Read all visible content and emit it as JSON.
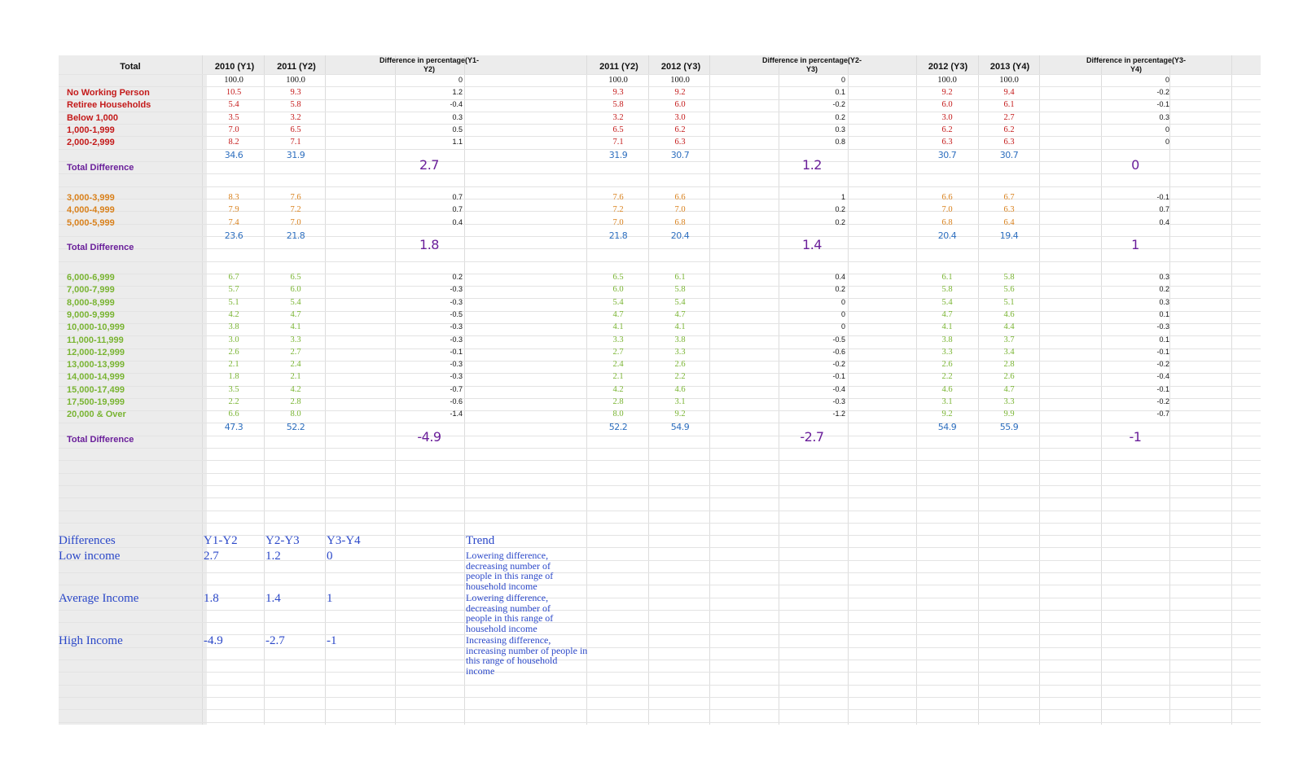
{
  "header": {
    "total": "Total",
    "c1": "2010 (Y1)",
    "c2": "2011 (Y2)",
    "d1": "Difference in percentage(Y1-Y2)",
    "c3": "2011 (Y2)",
    "c4": "2012 (Y3)",
    "d2": "Difference in percentage(Y2-Y3)",
    "c5": "2012 (Y3)",
    "c6": "2013 (Y4)",
    "d3": "Difference in percentage(Y3-Y4)"
  },
  "colors": {
    "low": "#c41a1a",
    "mid": "#d9811c",
    "high": "#79b432",
    "sum": "#2e6fbf",
    "total_diff": "#6a1f9a",
    "summary": "#2a47c8"
  },
  "rows": [
    {
      "label": "",
      "g": "base",
      "v": [
        "100.0",
        "100.0",
        "0",
        "100.0",
        "100.0",
        "0",
        "100.0",
        "100.0",
        "0"
      ]
    },
    {
      "label": "No Working Person",
      "g": "low",
      "v": [
        "10.5",
        "9.3",
        "1.2",
        "9.3",
        "9.2",
        "0.1",
        "9.2",
        "9.4",
        "-0.2"
      ]
    },
    {
      "label": "Retiree Households",
      "g": "low",
      "v": [
        "5.4",
        "5.8",
        "-0.4",
        "5.8",
        "6.0",
        "-0.2",
        "6.0",
        "6.1",
        "-0.1"
      ]
    },
    {
      "label": "Below 1,000",
      "g": "low",
      "v": [
        "3.5",
        "3.2",
        "0.3",
        "3.2",
        "3.0",
        "0.2",
        "3.0",
        "2.7",
        "0.3"
      ]
    },
    {
      "label": "1,000-1,999",
      "g": "low",
      "v": [
        "7.0",
        "6.5",
        "0.5",
        "6.5",
        "6.2",
        "0.3",
        "6.2",
        "6.2",
        "0"
      ]
    },
    {
      "label": "2,000-2,999",
      "g": "low",
      "v": [
        "8.2",
        "7.1",
        "1.1",
        "7.1",
        "6.3",
        "0.8",
        "6.3",
        "6.3",
        "0"
      ]
    },
    {
      "label": "",
      "g": "sum",
      "v": [
        "34.6",
        "31.9",
        "",
        "31.9",
        "30.7",
        "",
        "30.7",
        "30.7",
        ""
      ]
    },
    {
      "label": "Total Difference",
      "g": "td",
      "v": [
        "",
        "",
        "2.7",
        "",
        "",
        "1.2",
        "",
        "",
        "0"
      ]
    },
    {
      "label": "",
      "g": "blank",
      "v": []
    },
    {
      "label": "3,000-3,999",
      "g": "mid",
      "v": [
        "8.3",
        "7.6",
        "0.7",
        "7.6",
        "6.6",
        "1",
        "6.6",
        "6.7",
        "-0.1"
      ]
    },
    {
      "label": "4,000-4,999",
      "g": "mid",
      "v": [
        "7.9",
        "7.2",
        "0.7",
        "7.2",
        "7.0",
        "0.2",
        "7.0",
        "6.3",
        "0.7"
      ]
    },
    {
      "label": "5,000-5,999",
      "g": "mid",
      "v": [
        "7.4",
        "7.0",
        "0.4",
        "7.0",
        "6.8",
        "0.2",
        "6.8",
        "6.4",
        "0.4"
      ]
    },
    {
      "label": "",
      "g": "sum",
      "v": [
        "23.6",
        "21.8",
        "",
        "21.8",
        "20.4",
        "",
        "20.4",
        "19.4",
        ""
      ]
    },
    {
      "label": "Total Difference",
      "g": "td",
      "v": [
        "",
        "",
        "1.8",
        "",
        "",
        "1.4",
        "",
        "",
        "1"
      ]
    },
    {
      "label": "",
      "g": "blank",
      "v": []
    },
    {
      "label": "6,000-6,999",
      "g": "high",
      "v": [
        "6.7",
        "6.5",
        "0.2",
        "6.5",
        "6.1",
        "0.4",
        "6.1",
        "5.8",
        "0.3"
      ]
    },
    {
      "label": "7,000-7,999",
      "g": "high",
      "v": [
        "5.7",
        "6.0",
        "-0.3",
        "6.0",
        "5.8",
        "0.2",
        "5.8",
        "5.6",
        "0.2"
      ]
    },
    {
      "label": "8,000-8,999",
      "g": "high",
      "v": [
        "5.1",
        "5.4",
        "-0.3",
        "5.4",
        "5.4",
        "0",
        "5.4",
        "5.1",
        "0.3"
      ]
    },
    {
      "label": "9,000-9,999",
      "g": "high",
      "v": [
        "4.2",
        "4.7",
        "-0.5",
        "4.7",
        "4.7",
        "0",
        "4.7",
        "4.6",
        "0.1"
      ]
    },
    {
      "label": "10,000-10,999",
      "g": "high",
      "v": [
        "3.8",
        "4.1",
        "-0.3",
        "4.1",
        "4.1",
        "0",
        "4.1",
        "4.4",
        "-0.3"
      ]
    },
    {
      "label": "11,000-11,999",
      "g": "high",
      "v": [
        "3.0",
        "3.3",
        "-0.3",
        "3.3",
        "3.8",
        "-0.5",
        "3.8",
        "3.7",
        "0.1"
      ]
    },
    {
      "label": "12,000-12,999",
      "g": "high",
      "v": [
        "2.6",
        "2.7",
        "-0.1",
        "2.7",
        "3.3",
        "-0.6",
        "3.3",
        "3.4",
        "-0.1"
      ]
    },
    {
      "label": "13,000-13,999",
      "g": "high",
      "v": [
        "2.1",
        "2.4",
        "-0.3",
        "2.4",
        "2.6",
        "-0.2",
        "2.6",
        "2.8",
        "-0.2"
      ]
    },
    {
      "label": "14,000-14,999",
      "g": "high",
      "v": [
        "1.8",
        "2.1",
        "-0.3",
        "2.1",
        "2.2",
        "-0.1",
        "2.2",
        "2.6",
        "-0.4"
      ]
    },
    {
      "label": "15,000-17,499",
      "g": "high",
      "v": [
        "3.5",
        "4.2",
        "-0.7",
        "4.2",
        "4.6",
        "-0.4",
        "4.6",
        "4.7",
        "-0.1"
      ]
    },
    {
      "label": "17,500-19,999",
      "g": "high",
      "v": [
        "2.2",
        "2.8",
        "-0.6",
        "2.8",
        "3.1",
        "-0.3",
        "3.1",
        "3.3",
        "-0.2"
      ]
    },
    {
      "label": "20,000 & Over",
      "g": "high",
      "v": [
        "6.6",
        "8.0",
        "-1.4",
        "8.0",
        "9.2",
        "-1.2",
        "9.2",
        "9.9",
        "-0.7"
      ]
    },
    {
      "label": "",
      "g": "sum",
      "v": [
        "47.3",
        "52.2",
        "",
        "52.2",
        "54.9",
        "",
        "54.9",
        "55.9",
        ""
      ]
    },
    {
      "label": "Total Difference",
      "g": "td",
      "v": [
        "",
        "",
        "-4.9",
        "",
        "",
        "-2.7",
        "",
        "",
        "-1"
      ]
    }
  ],
  "summary": {
    "head": [
      "Differences",
      "Y1-Y2",
      "Y2-Y3",
      "Y3-Y4",
      "Trend"
    ],
    "rows": [
      {
        "label": "Low income",
        "a": "2.7",
        "b": "1.2",
        "c": "0",
        "trend": "Lowering difference, decreasing number of people in this range of household income"
      },
      {
        "label": "Average Income",
        "a": "1.8",
        "b": "1.4",
        "c": "1",
        "trend": "Lowering difference, decreasing number of people in this range of household income"
      },
      {
        "label": "High Income",
        "a": "-4.9",
        "b": "-2.7",
        "c": "-1",
        "trend": "Increasing difference, increasing number of people in this range of household income"
      }
    ]
  }
}
